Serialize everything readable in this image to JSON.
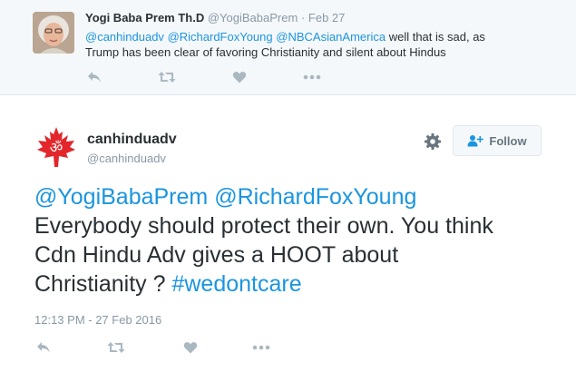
{
  "parent_tweet": {
    "name": "Yogi Baba Prem Th.D",
    "handle": "@YogiBabaPrem",
    "separator": "·",
    "date": "Feb 27",
    "mentions": [
      "@canhinduadv",
      "@RichardFoxYoung",
      "@NBCAsianAmerica"
    ],
    "text_line1_rest": " well that is sad, as",
    "text_line2": "Trump has been clear of favoring Christianity and silent about Hindus"
  },
  "main_tweet": {
    "name": "canhinduadv",
    "handle": "@canhinduadv",
    "follow_label": "Follow",
    "mentions": [
      "@YogiBabaPrem",
      "@RichardFoxYoung"
    ],
    "line2": "Everybody should protect their own. You think",
    "line3": "Cdn Hindu Adv gives a HOOT about",
    "line4_prefix": "Christianity ? ",
    "hashtag": "#wedontcare",
    "timestamp": "12:13 PM - 27 Feb 2016"
  },
  "icons": [
    "reply-icon",
    "retweet-icon",
    "like-icon",
    "more-icon",
    "gear-icon",
    "follow-person-icon"
  ],
  "colors": {
    "link": "#1b95e0",
    "muted": "#8899a6",
    "icon": "#aab8c2",
    "text": "#292f33",
    "brand_red": "#e3262b"
  }
}
